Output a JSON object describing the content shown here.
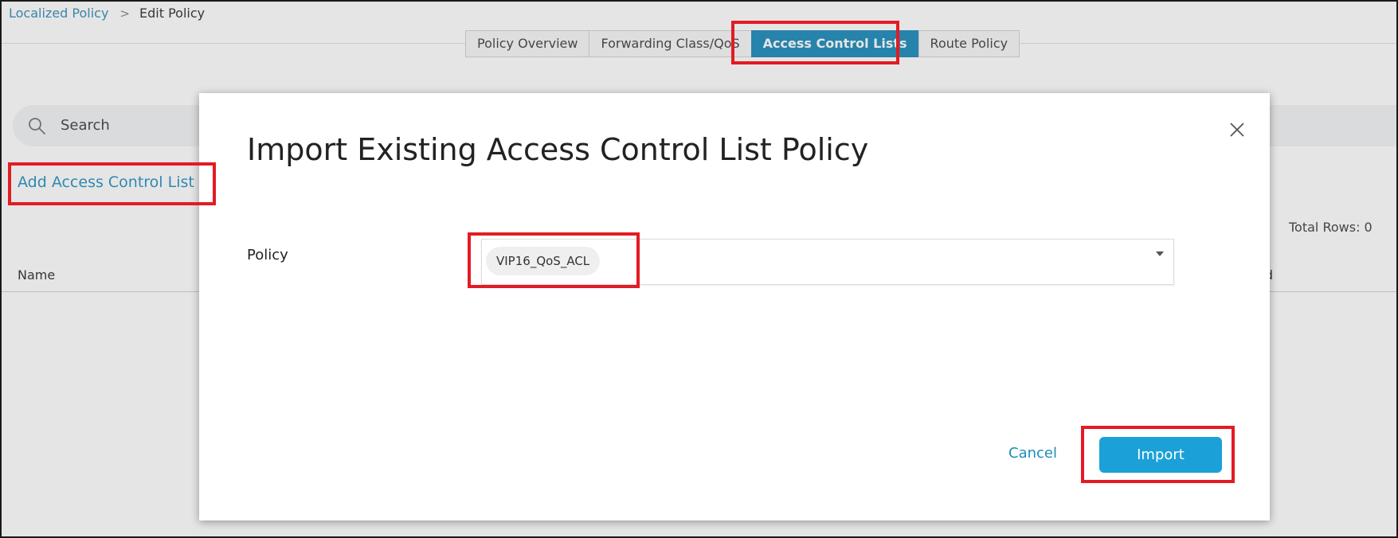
{
  "breadcrumb": {
    "parent": "Localized Policy",
    "current": "Edit Policy"
  },
  "tabs": [
    {
      "label": "Policy Overview"
    },
    {
      "label": "Forwarding Class/QoS"
    },
    {
      "label": "Access Control Lists",
      "active": true
    },
    {
      "label": "Route Policy"
    }
  ],
  "search": {
    "placeholder": "Search"
  },
  "add_acl_label": "Add Access Control List P",
  "table": {
    "total_rows": "Total Rows: 0",
    "col_name": "Name",
    "col_updated_partial": "ated"
  },
  "modal": {
    "title": "Import Existing Access Control List Policy",
    "policy_label": "Policy",
    "selected_policy": "VIP16_QoS_ACL",
    "cancel_label": "Cancel",
    "import_label": "Import"
  },
  "colors": {
    "accent": "#1ba0d7",
    "active_tab": "#1f8cbb",
    "annotation": "#e31b23"
  },
  "icons": [
    "search-icon",
    "close-icon",
    "chevron-down-icon"
  ]
}
